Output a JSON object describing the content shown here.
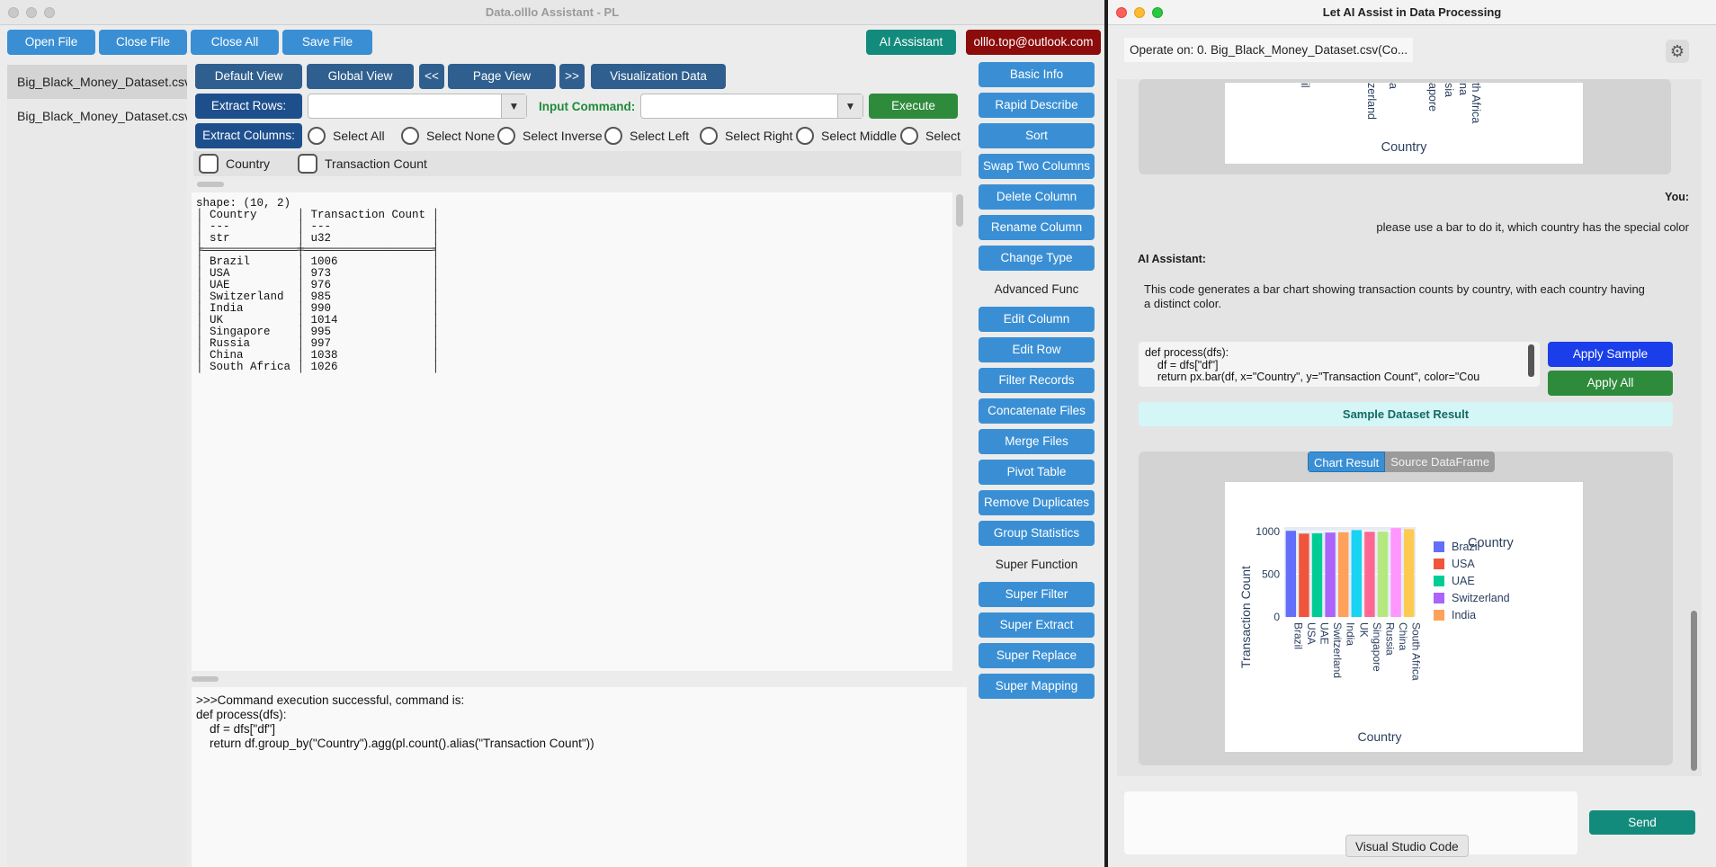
{
  "left_window": {
    "title": "Data.olllo Assistant - PL",
    "toolbar": {
      "open_file": "Open File",
      "close_file": "Close File",
      "close_all": "Close All",
      "save_file": "Save File",
      "ai_assistant": "AI Assistant",
      "email": "olllo.top@outlook.com"
    },
    "files": [
      "Big_Black_Money_Dataset.csv",
      "Big_Black_Money_Dataset.csv"
    ],
    "view": {
      "default_view": "Default View",
      "global_view": "Global View",
      "prev": "<<",
      "page_view": "Page View",
      "next": ">>",
      "visualization": "Visualization Data"
    },
    "extract_rows_label": "Extract Rows:",
    "input_command_label": "Input Command:",
    "execute": "Execute",
    "extract_columns_label": "Extract Columns:",
    "select_options": [
      "Select All",
      "Select None",
      "Select Inverse",
      "Select Left",
      "Select Right",
      "Select Middle",
      "Select"
    ],
    "columns": [
      "Country",
      "Transaction Count"
    ],
    "table_text": "shape: (10, 2)\n│ Country      │ Transaction Count │\n│ ---          │ ---               │\n│ str          │ u32               │\n╞══════════════╪═══════════════════╡\n│ Brazil       │ 1006              │\n│ USA          │ 973               │\n│ UAE          │ 976               │\n│ Switzerland  │ 985               │\n│ India        │ 990               │\n│ UK           │ 1014              │\n│ Singapore    │ 995               │\n│ Russia       │ 997               │\n│ China        │ 1038              │\n│ South Africa │ 1026              │",
    "console_text": ">>>Command execution successful, command is:\ndef process(dfs):\n    df = dfs[\"df\"]\n    return df.group_by(\"Country\").agg(pl.count().alias(\"Transaction Count\"))",
    "right_buttons": {
      "basic_info": "Basic Info",
      "rapid_describe": "Rapid Describe",
      "sort": "Sort",
      "swap_two_columns": "Swap Two Columns",
      "delete_column": "Delete Column",
      "rename_column": "Rename Column",
      "change_type": "Change Type",
      "advanced_func": "Advanced Func",
      "edit_column": "Edit Column",
      "edit_row": "Edit Row",
      "filter_records": "Filter Records",
      "concatenate_files": "Concatenate Files",
      "merge_files": "Merge Files",
      "pivot_table": "Pivot Table",
      "remove_duplicates": "Remove Duplicates",
      "group_statistics": "Group Statistics",
      "super_function": "Super Function",
      "super_filter": "Super Filter",
      "super_extract": "Super Extract",
      "super_replace": "Super Replace",
      "super_mapping": "Super Mapping"
    }
  },
  "right_window": {
    "title": "Let AI Assist in Data Processing",
    "operate_on": "Operate on: 0. Big_Black_Money_Dataset.csv(Co...",
    "prev_chart_ticks": [
      "il",
      "zerland",
      "a",
      "apore",
      "sia",
      "na",
      "th Africa"
    ],
    "prev_chart_xlabel": "Country",
    "you_label": "You:",
    "you_message": "please use a bar to do it, which country has the special color",
    "ai_label": "AI Assistant:",
    "ai_message": "This code generates a bar chart showing transaction counts by country, with each country having a distinct color.",
    "code_text": "def process(dfs):\n    df = dfs[\"df\"]\n    return px.bar(df, x=\"Country\", y=\"Transaction Count\", color=\"Cou",
    "apply_sample": "Apply Sample",
    "apply_all": "Apply All",
    "sample_result": "Sample Dataset Result",
    "tabs": {
      "chart": "Chart Result",
      "source": "Source DataFrame"
    },
    "send": "Send",
    "tooltip": "Visual Studio Code"
  },
  "chart_data": {
    "type": "bar",
    "categories": [
      "Brazil",
      "USA",
      "UAE",
      "Switzerland",
      "India",
      "UK",
      "Singapore",
      "Russia",
      "China",
      "South Africa"
    ],
    "values": [
      1006,
      973,
      976,
      985,
      990,
      1014,
      995,
      997,
      1038,
      1026
    ],
    "colors": [
      "#636efa",
      "#ef553b",
      "#00cc96",
      "#ab63fa",
      "#ffa15a",
      "#19d3f3",
      "#ff6692",
      "#b6e880",
      "#ff97ff",
      "#fecb52"
    ],
    "xlabel": "Country",
    "ylabel": "Transaction Count",
    "ylim": [
      0,
      1050
    ],
    "yticks": [
      0,
      500,
      1000
    ],
    "legend_title": "Country",
    "legend_visible": [
      "Brazil",
      "USA",
      "UAE",
      "Switzerland",
      "India"
    ]
  }
}
